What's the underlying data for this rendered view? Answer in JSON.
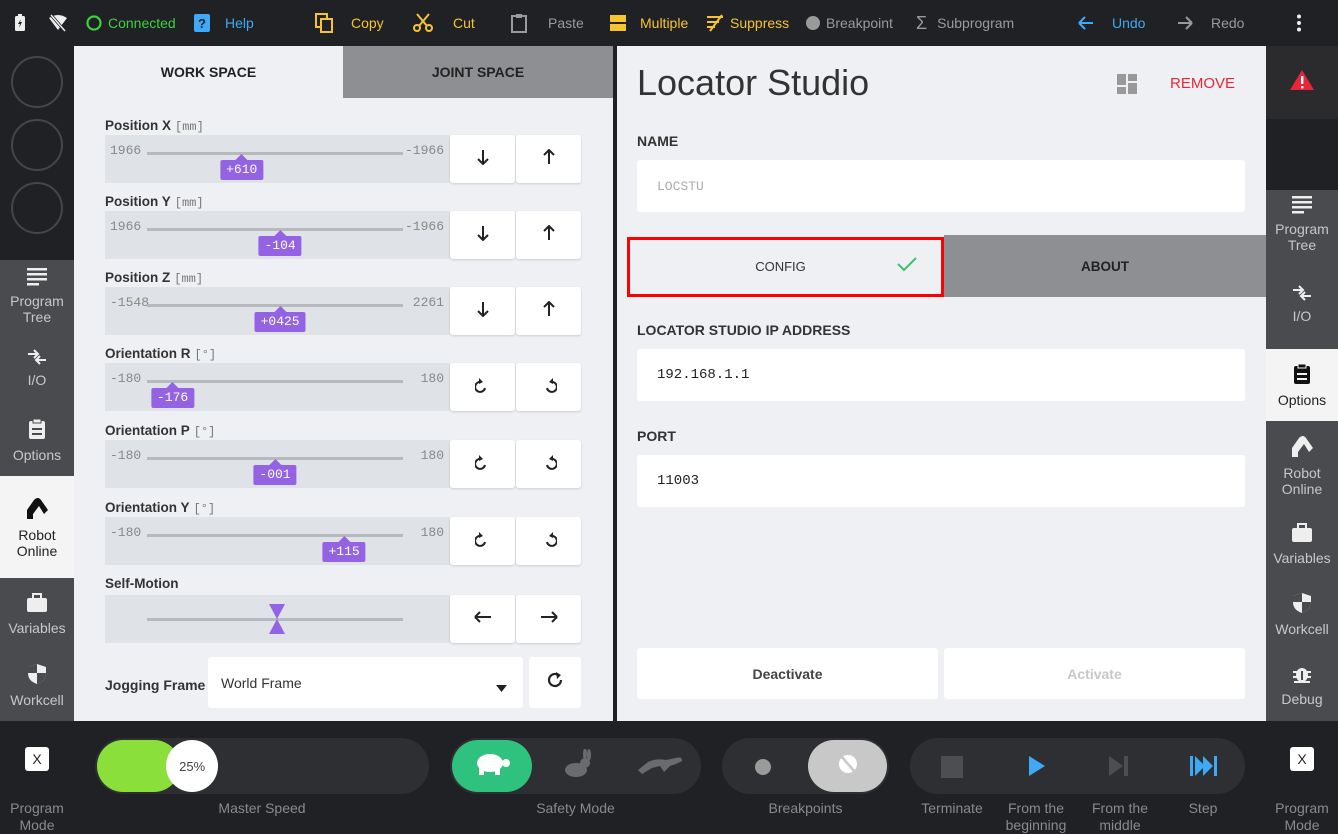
{
  "toolbar": {
    "connected": "Connected",
    "help": "Help",
    "copy": "Copy",
    "cut": "Cut",
    "paste": "Paste",
    "multiple": "Multiple",
    "suppress": "Suppress",
    "breakpoint": "Breakpoint",
    "subprogram": "Subprogram",
    "undo": "Undo",
    "redo": "Redo"
  },
  "left_nav": [
    {
      "label": "Program Tree",
      "icon": "program-tree-icon"
    },
    {
      "label": "I/O",
      "icon": "io-icon"
    },
    {
      "label": "Options",
      "icon": "options-icon"
    },
    {
      "label": "Robot Online",
      "icon": "robot-icon"
    },
    {
      "label": "Variables",
      "icon": "briefcase-icon"
    },
    {
      "label": "Workcell",
      "icon": "shield-icon"
    }
  ],
  "right_nav": [
    {
      "label": "Program Tree",
      "icon": "program-tree-icon"
    },
    {
      "label": "I/O",
      "icon": "io-icon"
    },
    {
      "label": "Options",
      "icon": "options-icon"
    },
    {
      "label": "Robot Online",
      "icon": "robot-icon"
    },
    {
      "label": "Variables",
      "icon": "briefcase-icon"
    },
    {
      "label": "Workcell",
      "icon": "shield-icon"
    },
    {
      "label": "Debug",
      "icon": "bug-icon"
    }
  ],
  "jog": {
    "tabs": {
      "work": "WORK SPACE",
      "joint": "JOINT SPACE"
    },
    "sliders": [
      {
        "label": "Position X",
        "unit": "[mm]",
        "min": "1966",
        "max": "-1966",
        "value": "+610",
        "fraction": 0.37
      },
      {
        "label": "Position Y",
        "unit": "[mm]",
        "min": "1966",
        "max": "-1966",
        "value": "-104",
        "fraction": 0.52
      },
      {
        "label": "Position Z",
        "unit": "[mm]",
        "min": "-1548",
        "max": "2261",
        "value": "+0425",
        "fraction": 0.52
      },
      {
        "label": "Orientation R",
        "unit": "[°]",
        "min": "-180",
        "max": "180",
        "value": "-176",
        "fraction": 0.1
      },
      {
        "label": "Orientation P",
        "unit": "[°]",
        "min": "-180",
        "max": "180",
        "value": "-001",
        "fraction": 0.5
      },
      {
        "label": "Orientation Y",
        "unit": "[°]",
        "min": "-180",
        "max": "180",
        "value": "+115",
        "fraction": 0.77
      }
    ],
    "self_motion": "Self-Motion",
    "frame_label": "Jogging Frame",
    "frame_value": "World Frame"
  },
  "locator": {
    "title": "Locator Studio",
    "remove": "REMOVE",
    "name_label": "NAME",
    "name_placeholder": "LOCSTU",
    "tab_config": "CONFIG",
    "tab_about": "ABOUT",
    "ip_label": "LOCATOR STUDIO IP ADDRESS",
    "ip_value": "192.168.1.1",
    "port_label": "PORT",
    "port_value": "11003",
    "deactivate": "Deactivate",
    "activate": "Activate"
  },
  "bottom": {
    "program_mode_x": "X",
    "program_mode": "Program Mode",
    "master_speed": "Master Speed",
    "speed_value": "25%",
    "speed_fraction": 0.25,
    "safety_mode": "Safety Mode",
    "breakpoints": "Breakpoints",
    "terminate": "Terminate",
    "from_beginning": "From the beginning",
    "from_middle": "From the middle",
    "step": "Step"
  },
  "colors": {
    "accent_purple": "#9463e4",
    "connected_green": "#3ed13e",
    "toolbar_yellow": "#f7c431",
    "undo_blue": "#3fa9f5",
    "remove_red": "#e8263a",
    "highlight_red": "#ff0000",
    "speed_green": "#8adf3a",
    "safety_green": "#2ec27e"
  }
}
